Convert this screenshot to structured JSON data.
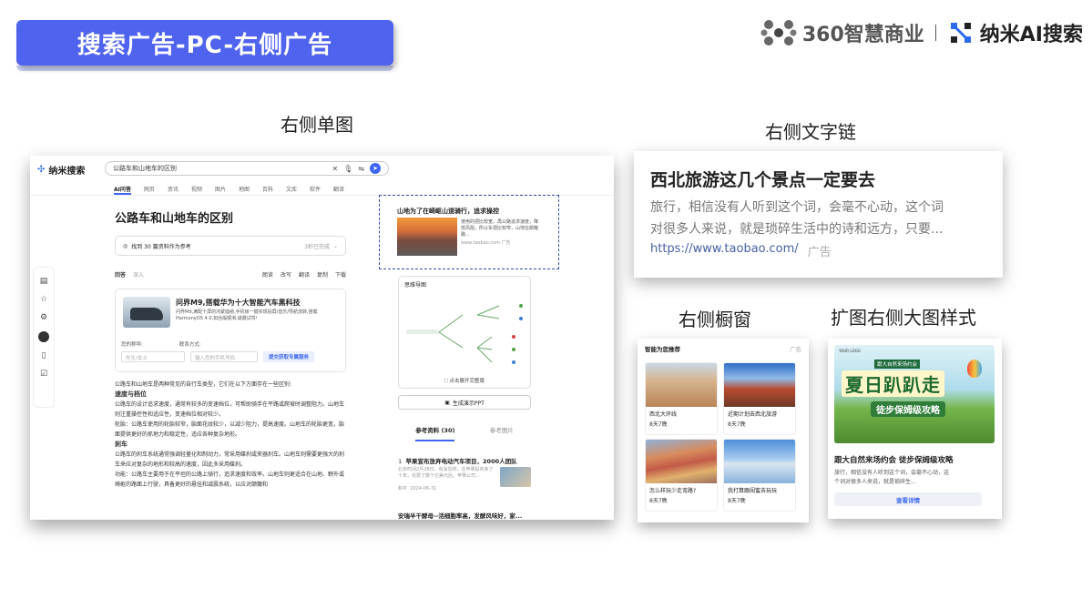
{
  "banner": {
    "title": "搜索广告-PC-右侧广告"
  },
  "logos": {
    "brand360": "360智慧商业",
    "nami": "纳米AI搜索"
  },
  "labels": {
    "single_image": "右侧单图",
    "text_link": "右侧文字链",
    "showcase": "右侧橱窗",
    "big_image": "扩图右侧大图样式"
  },
  "serp": {
    "brand": "纳米搜索",
    "query": "公路车和山地车的区别",
    "tabs": [
      "AI问答",
      "网页",
      "资讯",
      "视频",
      "图片",
      "地图",
      "百科",
      "文库",
      "软件",
      "翻译"
    ],
    "question_title": "公路车和山地车的区别",
    "refs_text": "找到 30 篇资料作为参考",
    "refs_time": "3秒已完成",
    "answer_label": "回答",
    "answer_mode": "深入",
    "actions": [
      "朗读",
      "改写",
      "翻译",
      "复制",
      "下载"
    ],
    "ad": {
      "title": "问界M9,搭载华为十大智能汽车黑科技",
      "desc": "问界M9,满配十屏的鸿蒙座舱,手机级一键实现投屏/音乐/导航流转,搭载HarmonyOS 4.0,如丝般顺滑,诚邀试驾!",
      "name_label": "您的称呼:",
      "name_placeholder": "先生/女士",
      "contact_label": "联系方式:",
      "contact_placeholder": "输入您的手机号码",
      "submit": "提交获取专属服务"
    },
    "body": {
      "intro": "公路车和山地车是两种常见的自行车类型，它们在以下方面存在一些区别:",
      "h1": "速度与档位",
      "p1": "公路车的设计追求速度，通常有较多的变速档位，可帮助骑手在平路或爬坡时调整阻力。山地车则注重操控性和适应性，变速档位相对较少。",
      "p2": "轮胎：公路车使用的轮胎较窄，胎面花纹较少，以减少阻力，提高速度。山地车的轮胎更宽，胎面提供更好的抓地力和稳定性，适应各种复杂地形。",
      "h2": "刹车",
      "p3": "公路车的刹车系统通常强调轻量化和制动力，常采用碟刹或夹器刹车。山地车则需要更强大的刹车来应对复杂的地形和较高的速度，因此多采用碟刹。",
      "p4": "功能：公路车主要用于在平坦的公路上骑行，追求速度和效率。山地车则更适合在山地、野外或崎岖的路面上行驶，具备更好的悬挂和减震系统，以应对颠簸和"
    },
    "right_ad": {
      "title": "山地为了在崎岖山道骑行，追求操控",
      "desc": "使用的把比较宽，再公路追求速度，降低风阻，所以车把比较窄，山地在颠簸路...",
      "url": "www.taobao.com  广告"
    },
    "mindmap_title": "思维导图",
    "mindmap_expand": "点击展开完整版",
    "ppt": "生成演示PPT",
    "ref_tabs": [
      "参考资料 (30)",
      "参考图片"
    ],
    "ref_item": {
      "num": "1",
      "title": "苹果宣布放弃电动汽车项目，2000人团队",
      "desc": "北京时间2月28日，有消息称，在苹果投资争了十年，花费了数十亿美元后。苹果公司...",
      "source": "和平",
      "date": "2024-06-31"
    },
    "ref_more": "安瑞半干酵母--活细胞率高，发酵风味好，家..."
  },
  "text_card": {
    "title": "西北旅游这几个景点一定要去",
    "desc1": "旅行，相信没有人听到这个词，会毫不心动，这个词",
    "desc2": "对很多人来说，就是琐碎生活中的诗和远方，只要...",
    "url": "https://www.taobao.com/",
    "ad": "广告"
  },
  "showcase": {
    "header": "智能为您推荐",
    "ad": "广告",
    "items": [
      {
        "name": "西北大环线",
        "price": "8天7晚"
      },
      {
        "name": "近期计划去西北旅游",
        "price": "8天7晚"
      },
      {
        "name": "怎么样玩少走弯路?",
        "price": "8天7晚"
      },
      {
        "name": "我打算跟闺蜜去玩玩",
        "price": "8天7晚"
      }
    ]
  },
  "big_card": {
    "logo": "YOUR LOGO",
    "sub": "跟大自然来场约会",
    "big": "夏日趴趴走",
    "tag": "徒步保姆级攻略",
    "title": "跟大自然来场约会 徒步保姆级攻略",
    "desc1": "旅行，相信没有人听到这个词，会毫不心动，这",
    "desc2": "个词对很多人来说，就是琐碎生...",
    "button": "查看详情"
  }
}
